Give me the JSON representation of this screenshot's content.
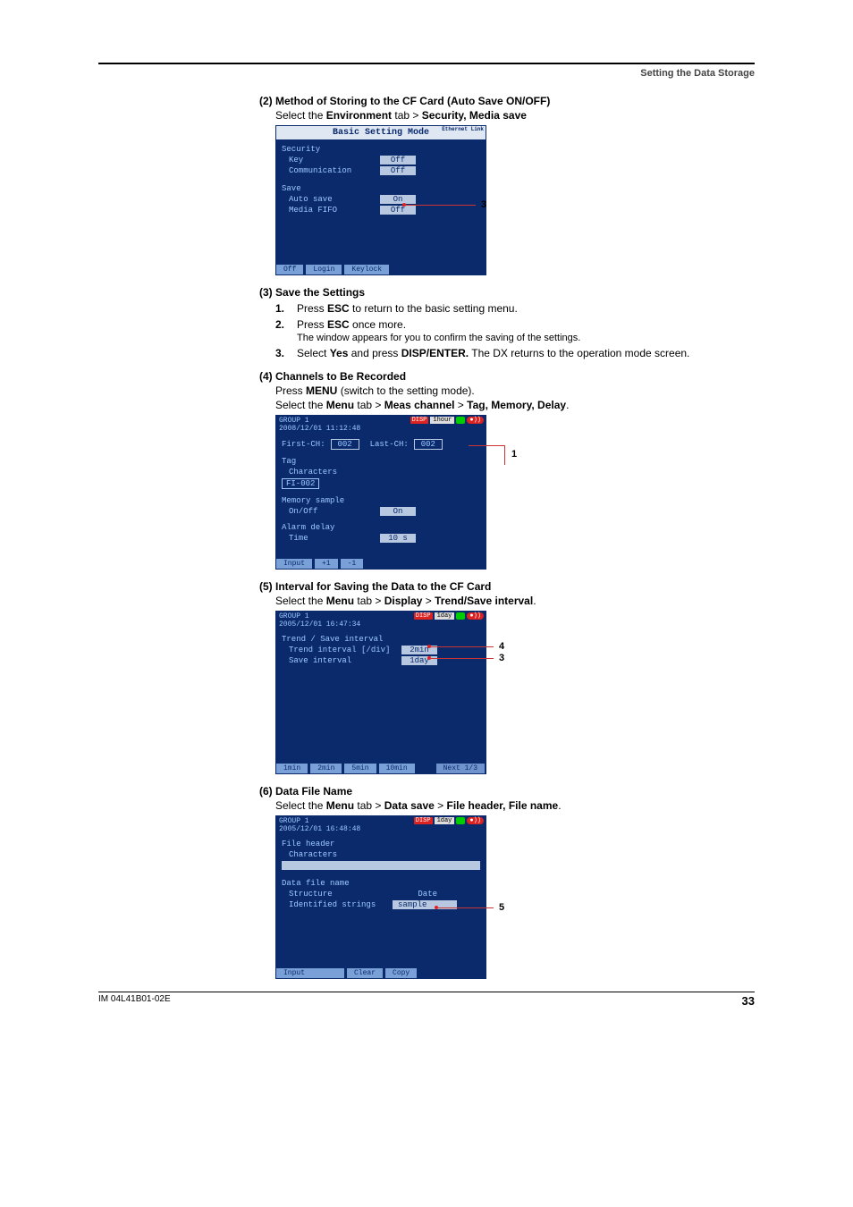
{
  "header": {
    "running_head": "Setting the Data Storage"
  },
  "s2": {
    "title": "(2) Method of Storing to the CF Card (Auto Save ON/OFF)",
    "instr_pre": "Select the ",
    "instr_b1": "Environment",
    "instr_mid": " tab > ",
    "instr_b2": "Security, Media save",
    "dev_title": "Basic Setting Mode",
    "eth": "Ethernet\nLink",
    "rows": {
      "security": "Security",
      "key": "Key",
      "key_val": "Off",
      "comm": "Communication",
      "comm_val": "Off",
      "save": "Save",
      "autosave": "Auto save",
      "autosave_val": "On",
      "media": "Media FIFO",
      "media_val": "Off"
    },
    "footer": [
      "Off",
      "Login",
      "Keylock"
    ],
    "callout": "3"
  },
  "s3": {
    "title": "(3) Save the Settings",
    "steps": [
      {
        "n": "1.",
        "pre": "Press ",
        "b": "ESC",
        "post": " to return to the basic setting menu."
      },
      {
        "n": "2.",
        "pre": "Press ",
        "b": "ESC",
        "post": " once more.",
        "sub": "The window appears for you to confirm the saving of the settings."
      },
      {
        "n": "3.",
        "pre": "Select ",
        "b": "Yes",
        "mid": " and press ",
        "b2": "DISP/ENTER.",
        "post": " The DX returns to the operation mode screen."
      }
    ]
  },
  "s4": {
    "title": "(4) Channels to Be Recorded",
    "l1_pre": "Press ",
    "l1_b": "MENU",
    "l1_post": " (switch to the setting mode).",
    "l2_pre": "Select the ",
    "l2_b1": "Menu",
    "l2_m1": " tab > ",
    "l2_b2": "Meas channel",
    "l2_m2": " > ",
    "l2_b3": "Tag, Memory, Delay",
    "l2_end": ".",
    "dev": {
      "grp": "GROUP 1",
      "dt": "2008/12/01 11:12:48",
      "disp": "DISP",
      "time": "1hour",
      "first": "First-CH:",
      "first_v": "002",
      "last": "Last-CH:",
      "last_v": "002",
      "tag": "Tag",
      "chars": "Characters",
      "chars_v": "FI-002",
      "mem": "Memory sample",
      "onoff": "On/Off",
      "onoff_v": "On",
      "alarm": "Alarm delay",
      "time_lbl": "Time",
      "time_v": "10 s",
      "footer": [
        "Input",
        "+1",
        "-1"
      ]
    },
    "callout": "1"
  },
  "s5": {
    "title": "(5) Interval for Saving the Data to the CF Card",
    "instr_pre": "Select the ",
    "instr_b1": "Menu",
    "instr_m1": " tab > ",
    "instr_b2": "Display",
    "instr_m2": " > ",
    "instr_b3": "Trend/Save interval",
    "instr_end": ".",
    "dev": {
      "grp": "GROUP 1",
      "dt": "2005/12/01 16:47:34",
      "disp": "DISP",
      "time": "1day",
      "hdr": "Trend / Save interval",
      "r1": "Trend interval [/div]",
      "r1_v": "2min",
      "r2": "Save interval",
      "r2_v": "1day",
      "footer": [
        "1min",
        "2min",
        "5min",
        "10min",
        "Next 1/3"
      ]
    },
    "callout4": "4",
    "callout3": "3"
  },
  "s6": {
    "title": "(6) Data File Name",
    "instr_pre": "Select the ",
    "instr_b1": "Menu",
    "instr_m1": " tab > ",
    "instr_b2": "Data save",
    "instr_m2": " > ",
    "instr_b3": "File header, File name",
    "instr_end": ".",
    "dev": {
      "grp": "GROUP 1",
      "dt": "2005/12/01 16:48:48",
      "disp": "DISP",
      "time": "1day",
      "r1": "File header",
      "r2": "Characters",
      "r3": "Data file name",
      "r4": "Structure",
      "r4_v": "Date",
      "r5": "Identified strings",
      "r5_v": "sample",
      "footer": [
        "Input",
        "Clear",
        "Copy"
      ]
    },
    "callout": "5"
  },
  "footer": {
    "doc": "IM 04L41B01-02E",
    "page": "33"
  }
}
